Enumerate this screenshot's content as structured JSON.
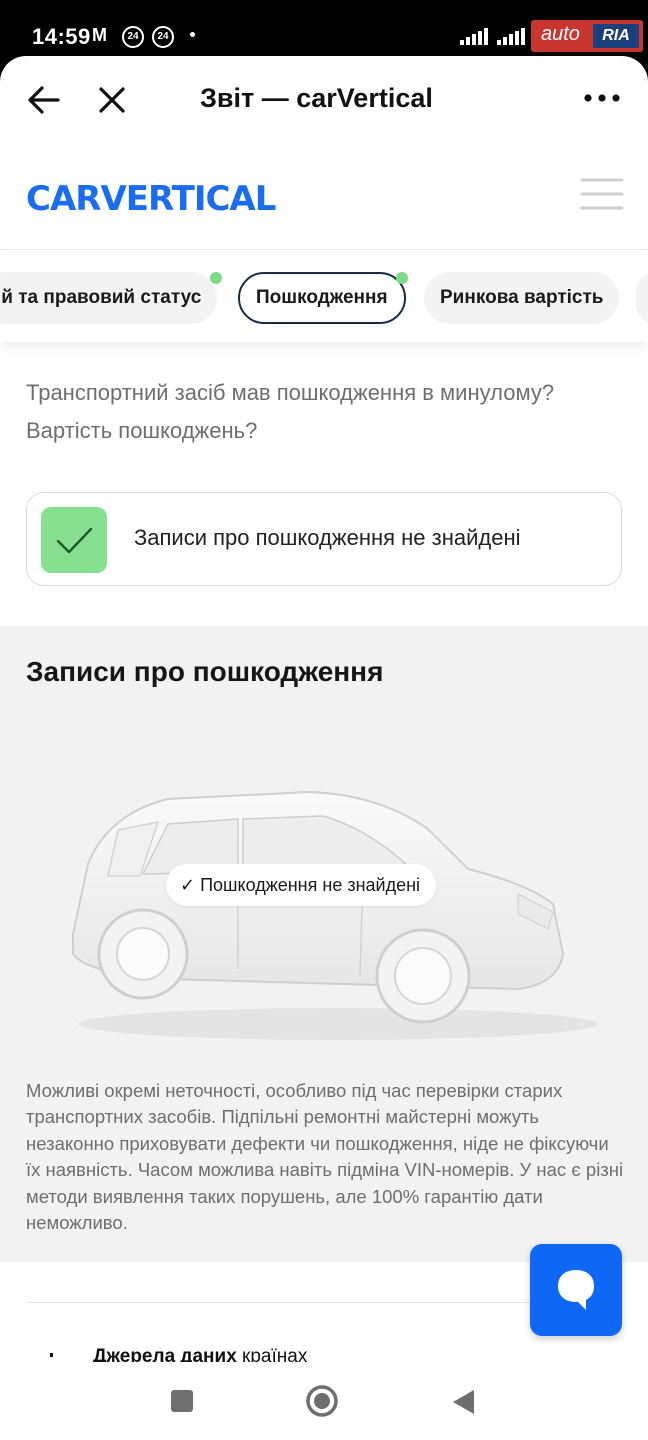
{
  "status_bar": {
    "time": "14:59",
    "mail_icon": "M",
    "badge1": "24",
    "badge2": "24",
    "ad_brand_left": "auto",
    "ad_brand_right": "RIA"
  },
  "topbar": {
    "title": "Звіт — carVertical"
  },
  "header": {
    "logo_text": "CARVERTICAL",
    "brand_color": "#1a6cf0"
  },
  "tabs": [
    {
      "label": "ій та правовий статус",
      "active": false,
      "has_dot": true
    },
    {
      "label": "Пошкодження",
      "active": true,
      "has_dot": true
    },
    {
      "label": "Ринкова вартість",
      "active": false,
      "has_dot": false
    }
  ],
  "question": "Транспортний засіб мав пошкодження в минулому? Вартість пошкоджень?",
  "status_card": {
    "text": "Записи про пошкодження не знайдені",
    "icon": "check-icon",
    "icon_bg": "#86e08f"
  },
  "damage": {
    "title": "Записи про пошкодження",
    "badge": "Пошкодження не знайдені",
    "disclaimer": "Можливі окремі неточності, особливо під час перевірки старих транспортних засобів. Підпільні ремонтні майстерні можуть незаконно приховувати дефекти чи пошкодження, ніде не фіксуючи їх наявність. Часом можлива навіть підміна VIN-номерів. У нас є різні методи виявлення таких порушень, але 100% гарантію дати неможливо."
  },
  "sources": {
    "bold": "Джерела даних",
    "rest": " країнах"
  },
  "chat": {
    "icon": "chat-bubble-icon",
    "color": "#0f67f5"
  },
  "navbar": {
    "icons": [
      "recents-icon",
      "home-icon",
      "back-triangle-icon"
    ]
  }
}
